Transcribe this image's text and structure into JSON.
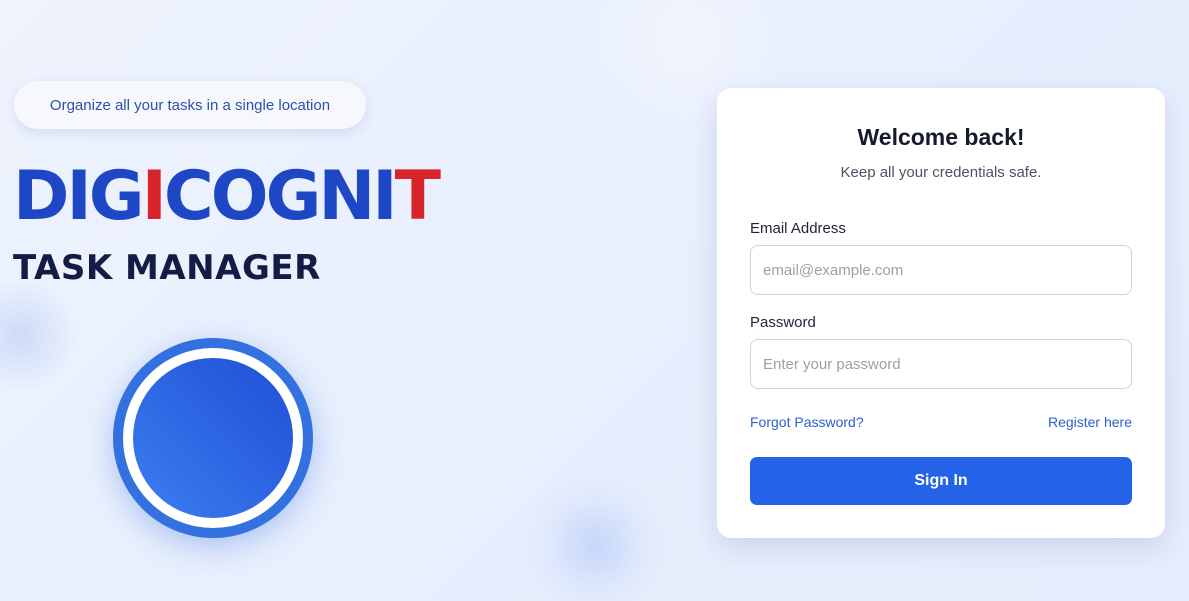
{
  "hero": {
    "tagline": "Organize all your tasks in a single location",
    "brand": {
      "segments": [
        {
          "text": "DIG",
          "color": "#1d47c4"
        },
        {
          "text": "I",
          "color": "#d8242b"
        },
        {
          "text": "COGNI",
          "color": "#1d47c4"
        },
        {
          "text": "T",
          "color": "#d8242b"
        }
      ]
    },
    "subtitle": "TASK MANAGER",
    "logo_icon": "circle-logo-icon"
  },
  "login": {
    "title": "Welcome back!",
    "subtitle": "Keep all your credentials safe.",
    "email_label": "Email Address",
    "email_placeholder": "email@example.com",
    "email_value": "",
    "password_label": "Password",
    "password_placeholder": "Enter your password",
    "password_value": "",
    "forgot_link": "Forgot Password?",
    "register_link": "Register here",
    "submit_label": "Sign In"
  },
  "colors": {
    "primary": "#2463e8",
    "brand_blue": "#1d47c4",
    "brand_red": "#d8242b",
    "link": "#2a5fcf",
    "heading": "#131c45"
  }
}
